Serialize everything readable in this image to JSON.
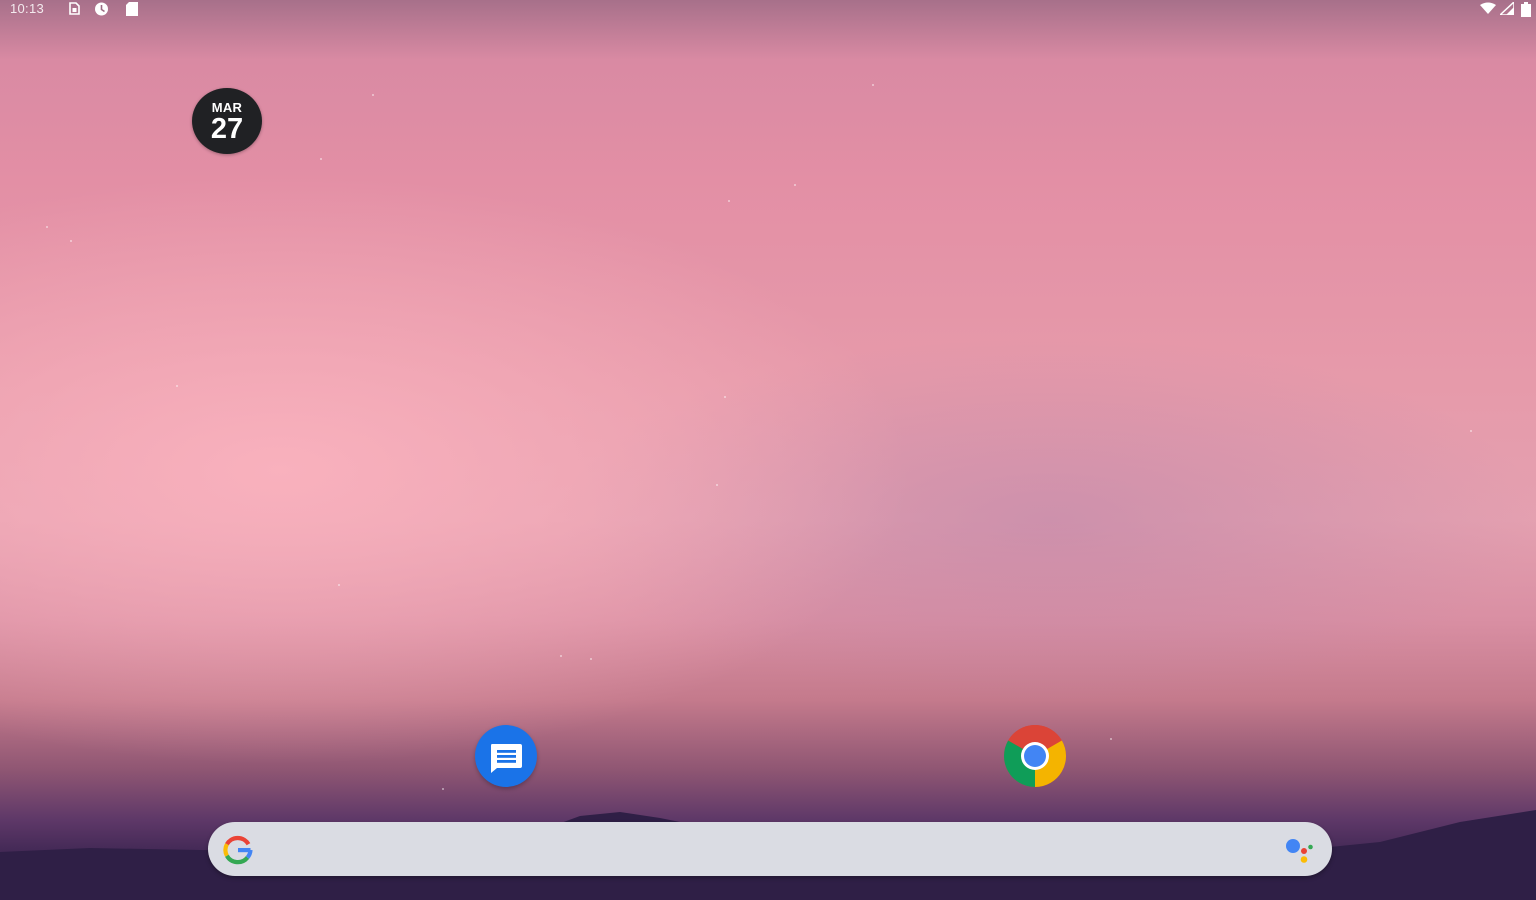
{
  "status_bar": {
    "time": "10:13",
    "left_icons": [
      "sim-card-icon",
      "sync-icon",
      "sd-card-icon"
    ],
    "right_icons": [
      "wifi-icon",
      "signal-icon",
      "battery-icon"
    ]
  },
  "date_widget": {
    "month": "MAR",
    "day": "27"
  },
  "apps": [
    {
      "name": "messages-app-icon",
      "color": "#1a73e8"
    },
    {
      "name": "chrome-app-icon"
    }
  ],
  "search_bar": {
    "left_icon": "google-g-icon",
    "right_icon": "google-assistant-icon",
    "background": "#dadce3"
  },
  "colors": {
    "google_blue": "#4285f4",
    "google_red": "#ea4335",
    "google_yellow": "#fbbc05",
    "google_green": "#34a853"
  }
}
